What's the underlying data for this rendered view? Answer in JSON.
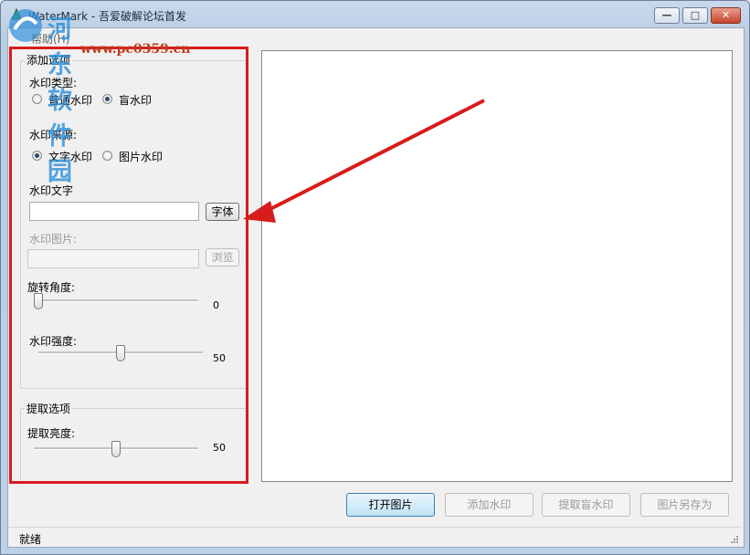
{
  "window": {
    "title": "WaterMark - 吾爱破解论坛首发",
    "minimize_glyph": "—",
    "maximize_glyph": "□",
    "close_glyph": "✕"
  },
  "menu": {
    "help": "帮助(H)"
  },
  "overlay_watermark": {
    "text": "河东软件园",
    "url": "www.pc0359.cn"
  },
  "add_options": {
    "legend": "添加选项",
    "watermark_type": {
      "label": "水印类型:",
      "options": [
        "普通水印",
        "盲水印"
      ],
      "selected": "盲水印"
    },
    "watermark_source": {
      "label": "水印来源:",
      "options": [
        "文字水印",
        "图片水印"
      ],
      "selected": "文字水印"
    },
    "watermark_text": {
      "label": "水印文字",
      "value": "",
      "font_button": "字体"
    },
    "watermark_image": {
      "label": "水印图片:",
      "value": "",
      "browse_button": "浏览"
    },
    "rotation": {
      "label": "旋转角度:",
      "value": "0"
    },
    "strength": {
      "label": "水印强度:",
      "value": "50"
    }
  },
  "extract_options": {
    "legend": "提取选项",
    "brightness": {
      "label": "提取亮度:",
      "value": "50"
    }
  },
  "actions": {
    "open_image": "打开图片",
    "add_watermark": "添加水印",
    "extract_blind": "提取盲水印",
    "save_as": "图片另存为"
  },
  "status": {
    "text": "就绪"
  },
  "colors": {
    "highlight": "#d71c1c",
    "accent": "#3c7fb1"
  },
  "slider_levels": {
    "rotation": 0.0,
    "strength": 0.5,
    "brightness": 0.5
  }
}
